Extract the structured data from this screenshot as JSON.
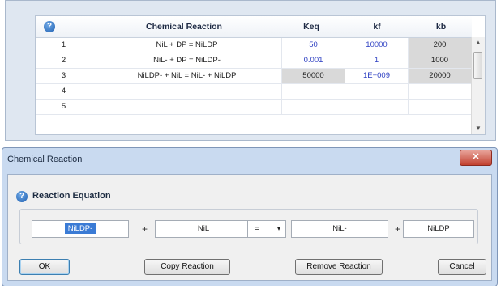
{
  "grid": {
    "help_glyph": "?",
    "columns": [
      "Chemical Reaction",
      "Keq",
      "kf",
      "kb"
    ],
    "rows": [
      {
        "num": "1",
        "reaction": "NiL + DP = NiLDP",
        "keq": "50",
        "kf": "10000",
        "kb": "200"
      },
      {
        "num": "2",
        "reaction": "NiL- + DP = NiLDP-",
        "keq": "0.001",
        "kf": "1",
        "kb": "1000"
      },
      {
        "num": "3",
        "reaction": "NiLDP- + NiL = NiL- + NiLDP",
        "keq": "50000",
        "kf": "1E+009",
        "kb": "20000"
      },
      {
        "num": "4",
        "reaction": "",
        "keq": "",
        "kf": "",
        "kb": ""
      },
      {
        "num": "5",
        "reaction": "",
        "keq": "",
        "kf": "",
        "kb": ""
      }
    ],
    "scroll_up": "▲",
    "scroll_down": "▼"
  },
  "dialog": {
    "title": "Chemical Reaction",
    "close_glyph": "✕",
    "section_help_glyph": "?",
    "section_title": "Reaction Equation",
    "equation": {
      "reactant1": "NiLDP-",
      "plus1": "+",
      "reactant2": "NiL",
      "operator": "=",
      "operator_dd": "▾",
      "product1": "NiL-",
      "plus2": "+",
      "product2": "NiLDP"
    },
    "buttons": {
      "ok": "OK",
      "copy": "Copy Reaction",
      "remove": "Remove Reaction",
      "cancel": "Cancel"
    }
  }
}
